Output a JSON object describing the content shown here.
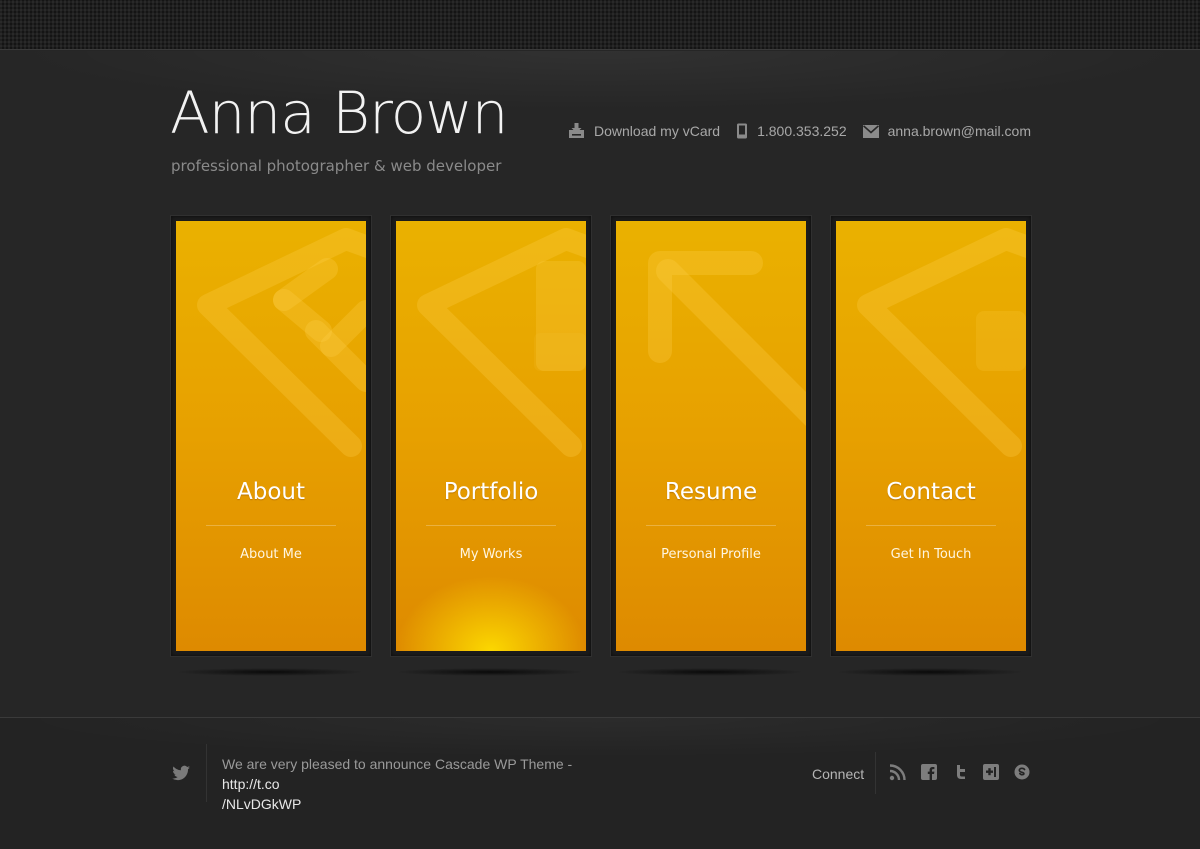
{
  "header": {
    "title": "Anna Brown",
    "tagline": "professional photographer & web developer"
  },
  "contact_bar": {
    "vcard_label": "Download my vCard",
    "phone": "1.800.353.252",
    "email": "anna.brown@mail.com"
  },
  "tiles": [
    {
      "title": "About",
      "subtitle": "About Me"
    },
    {
      "title": "Portfolio",
      "subtitle": "My Works"
    },
    {
      "title": "Resume",
      "subtitle": "Personal Profile"
    },
    {
      "title": "Contact",
      "subtitle": "Get In Touch"
    }
  ],
  "footer": {
    "tweet_text": "We are very pleased to announce Cascade WP Theme - ",
    "tweet_link_line1": "http://t.co",
    "tweet_link_line2": "/NLvDGkWP",
    "connect_label": "Connect",
    "social_icons": [
      "rss-icon",
      "facebook-icon",
      "twitter-icon",
      "google-plus-icon",
      "skype-icon"
    ]
  },
  "colors": {
    "background": "#262626",
    "tile_accent": "#e7a000",
    "title_text": "#f2f2f2"
  }
}
